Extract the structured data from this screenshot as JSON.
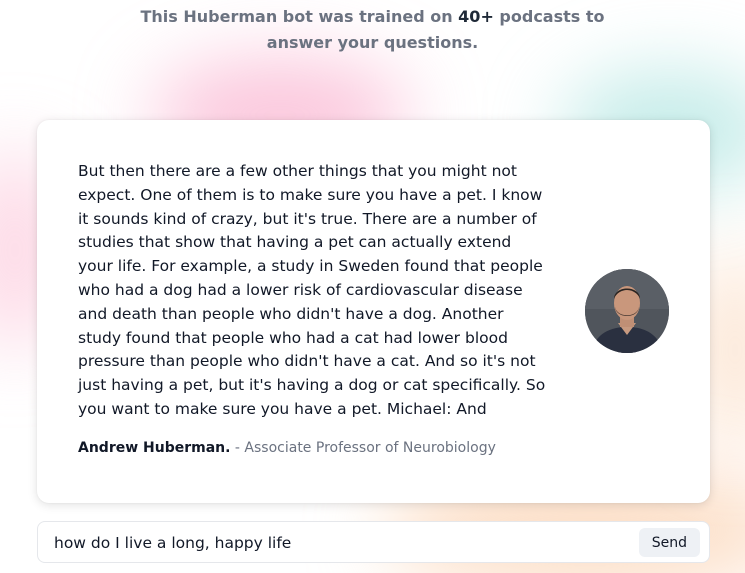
{
  "headline": {
    "before": "This Huberman bot was trained on ",
    "count": "40+",
    "after_line1": " podcasts to",
    "line2": "answer your questions."
  },
  "answer_card": {
    "quote": "But then there are a few other things that you might not expect. One of them is to make sure you have a pet. I know it sounds kind of crazy, but it's true. There are a number of studies that show that having a pet can actually extend your life. For example, a study in Sweden found that people who had a dog had a lower risk of cardiovascular disease and death than people who didn't have a dog. Another study found that people who had a cat had lower blood pressure than people who didn't have a cat. And so it's not just having a pet, but it's having a dog or cat specifically. So you want to make sure you have a pet. Michael: And",
    "author_name": "Andrew Huberman.",
    "author_role": " - Associate Professor of Neurobiology"
  },
  "chat_input": {
    "value": "how do I live a long, happy life",
    "send_label": "Send"
  },
  "colors": {
    "text_primary": "#111827",
    "text_muted": "#6b7280",
    "send_button_bg": "#eef1f5"
  }
}
